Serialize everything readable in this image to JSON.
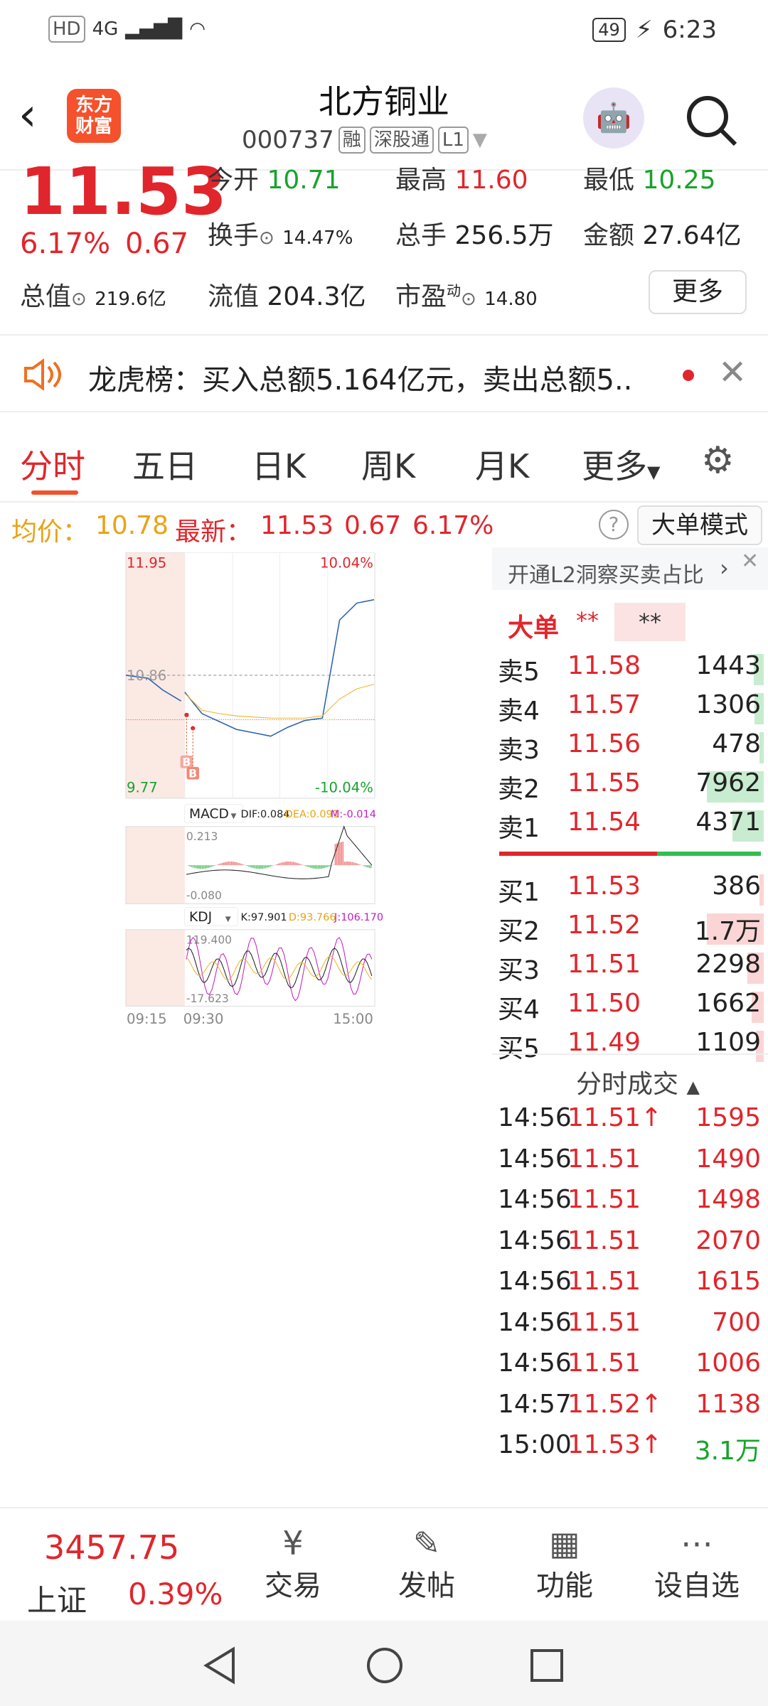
{
  "status_bar": {
    "hd": "HD",
    "network": "4G",
    "battery": "49",
    "time": "6:23"
  },
  "header": {
    "title": "北方铜业",
    "code": "000737",
    "tags": [
      "融",
      "深股通",
      "L1"
    ],
    "logo_text": [
      "东方",
      "财富"
    ]
  },
  "quote": {
    "price": "11.53",
    "change_pct": "6.17%",
    "change": "0.67",
    "open_label": "今开",
    "open": "10.71",
    "high_label": "最高",
    "high": "11.60",
    "low_label": "最低",
    "low": "10.25",
    "turnover_label": "换手",
    "turnover": "14.47%",
    "volume_label": "总手",
    "volume": "256.5万",
    "amount_label": "金额",
    "amount": "27.64亿",
    "mktcap_label": "总值",
    "mktcap": "219.6亿",
    "float_label": "流值",
    "float": "204.3亿",
    "pe_label": "市盈",
    "pe_sup": "动",
    "pe": "14.80",
    "more_label": "更多"
  },
  "notice": {
    "text": "龙虎榜：买入总额5.164亿元，卖出总额5.."
  },
  "tabs": [
    "分时",
    "五日",
    "日K",
    "周K",
    "月K",
    "更多"
  ],
  "info_row": {
    "avg_label": "均价：",
    "avg": "10.78",
    "last_label": "最新：",
    "last": "11.53",
    "chg": "0.67",
    "pct": "6.17%",
    "mode_btn": "大单模式"
  },
  "chart": {
    "y_top": "11.95",
    "y_bottom": "9.77",
    "pct_top": "10.04%",
    "pct_bottom": "-10.04%",
    "mid": "10.86",
    "x_labels": [
      "09:15",
      "09:30",
      "15:00"
    ],
    "markers": [
      "B",
      "B"
    ],
    "macd": {
      "name": "MACD",
      "dif": "DIF:0.084",
      "dea": "DEA:0.091",
      "m": "M:-0.014",
      "top": "0.213",
      "bottom": "-0.080"
    },
    "kdj": {
      "name": "KDJ",
      "k": "K:97.901",
      "d": "D:93.766",
      "j": "J:106.170",
      "top": "119.400",
      "bottom": "-17.623"
    }
  },
  "chart_data": {
    "type": "line",
    "x": [
      "09:30",
      "10:00",
      "10:30",
      "11:00",
      "11:30",
      "13:00",
      "13:30",
      "14:00",
      "14:15",
      "14:30",
      "14:45",
      "15:00"
    ],
    "series": [
      {
        "values": [
          10.71,
          10.52,
          10.45,
          10.38,
          10.35,
          10.32,
          10.4,
          10.46,
          10.48,
          11.35,
          11.5,
          11.53
        ]
      },
      {
        "values": [
          10.7,
          10.55,
          10.52,
          10.5,
          10.49,
          10.48,
          10.48,
          10.48,
          10.5,
          10.65,
          10.74,
          10.78
        ]
      }
    ],
    "ylim": [
      9.77,
      11.95
    ]
  },
  "side": {
    "l2_link": "开通L2洞察买卖占比",
    "big_label": "大单",
    "big_val1": "**",
    "big_val2": "**",
    "asks": [
      {
        "l": "卖5",
        "p": "11.58",
        "v": "1443"
      },
      {
        "l": "卖4",
        "p": "11.57",
        "v": "1306"
      },
      {
        "l": "卖3",
        "p": "11.56",
        "v": "478"
      },
      {
        "l": "卖2",
        "p": "11.55",
        "v": "7962"
      },
      {
        "l": "卖1",
        "p": "11.54",
        "v": "4371"
      }
    ],
    "bids": [
      {
        "l": "买1",
        "p": "11.53",
        "v": "386"
      },
      {
        "l": "买2",
        "p": "11.52",
        "v": "1.7万"
      },
      {
        "l": "买3",
        "p": "11.51",
        "v": "2298"
      },
      {
        "l": "买4",
        "p": "11.50",
        "v": "1662"
      },
      {
        "l": "买5",
        "p": "11.49",
        "v": "1109"
      }
    ],
    "trades_title": "分时成交",
    "trades": [
      {
        "t": "14:56",
        "p": "11.51",
        "a": "↑",
        "v": "1595"
      },
      {
        "t": "14:56",
        "p": "11.51",
        "a": "",
        "v": "1490"
      },
      {
        "t": "14:56",
        "p": "11.51",
        "a": "",
        "v": "1498"
      },
      {
        "t": "14:56",
        "p": "11.51",
        "a": "",
        "v": "2070"
      },
      {
        "t": "14:56",
        "p": "11.51",
        "a": "",
        "v": "1615"
      },
      {
        "t": "14:56",
        "p": "11.51",
        "a": "",
        "v": "700"
      },
      {
        "t": "14:56",
        "p": "11.51",
        "a": "",
        "v": "1006"
      },
      {
        "t": "14:57",
        "p": "11.52",
        "a": "↑",
        "v": "1138"
      },
      {
        "t": "15:00",
        "p": "11.53",
        "a": "↑",
        "v": "3.1万"
      }
    ]
  },
  "bottom": {
    "index_value": "3457.75",
    "index_name": "上证",
    "index_pct": "0.39%",
    "items": [
      "交易",
      "发帖",
      "功能",
      "设自选"
    ]
  }
}
